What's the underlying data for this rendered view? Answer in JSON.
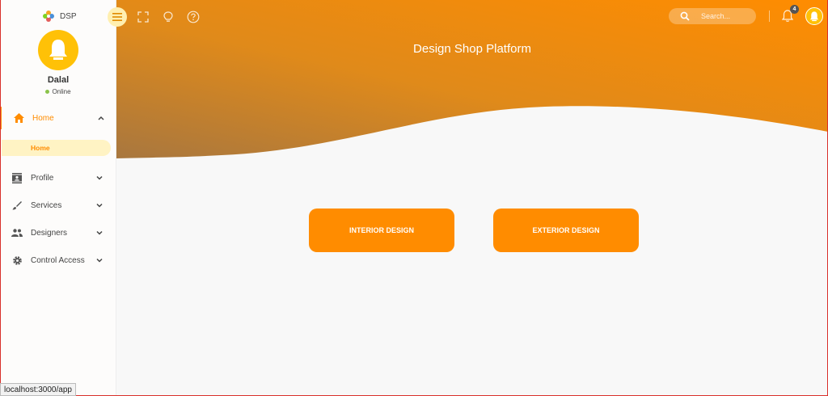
{
  "brand": {
    "name": "DSP"
  },
  "user": {
    "name": "Dalal",
    "status": "Online"
  },
  "nav": {
    "home": "Home",
    "home_sub": "Home",
    "profile": "Profile",
    "services": "Services",
    "designers": "Designers",
    "control_access": "Control Access"
  },
  "header": {
    "title": "Design Shop Platform",
    "search_placeholder": "Search...",
    "notification_count": "4"
  },
  "main": {
    "interior_button": "INTERIOR DESIGN",
    "exterior_button": "EXTERIOR DESIGN"
  },
  "status_bar": {
    "url": "localhost:3000/app"
  },
  "colors": {
    "accent": "#ff8c00",
    "hero_start": "#b07a3d",
    "hero_end": "#ff8c00",
    "avatar": "#ffc107"
  },
  "icons": [
    "menu-icon",
    "fullscreen-icon",
    "bulb-icon",
    "help-icon",
    "search-icon",
    "bell-icon",
    "home-icon",
    "profile-icon",
    "brush-icon",
    "people-icon",
    "gear-icon",
    "chevron-up-icon",
    "chevron-down-icon"
  ]
}
